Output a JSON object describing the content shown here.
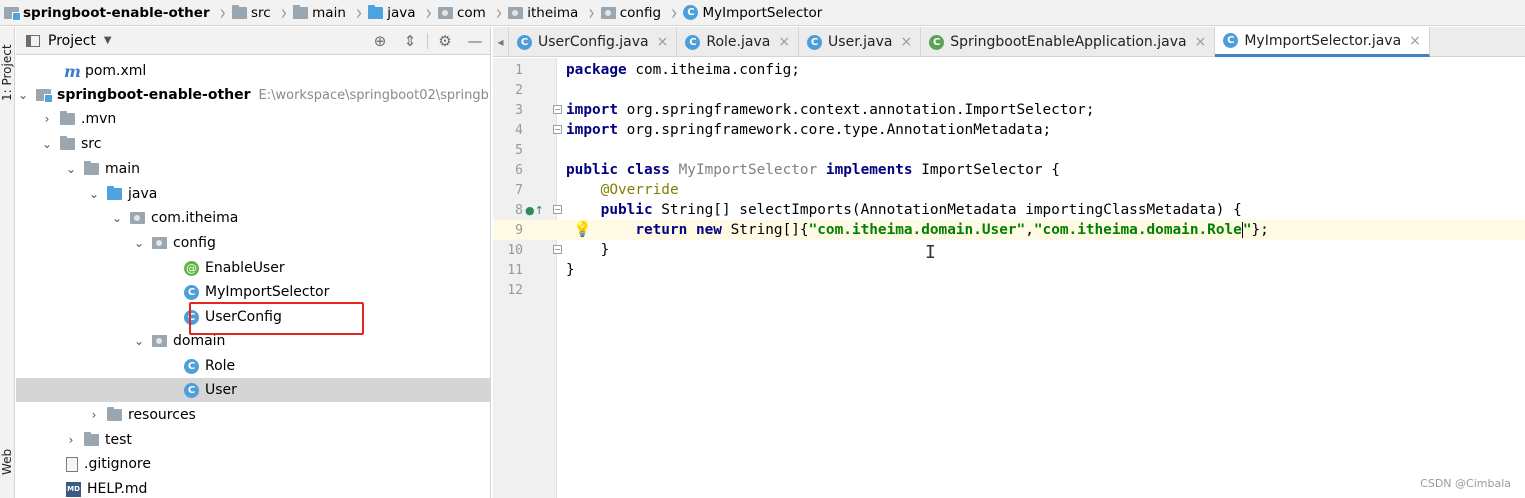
{
  "breadcrumb": [
    {
      "label": "springboot-enable-other",
      "icon": "module-icon"
    },
    {
      "label": "src",
      "icon": "folder-icon"
    },
    {
      "label": "main",
      "icon": "folder-icon"
    },
    {
      "label": "java",
      "icon": "source-folder-icon"
    },
    {
      "label": "com",
      "icon": "package-icon"
    },
    {
      "label": "itheima",
      "icon": "package-icon"
    },
    {
      "label": "config",
      "icon": "package-icon"
    },
    {
      "label": "MyImportSelector",
      "icon": "class-icon"
    }
  ],
  "left_stripe": {
    "project_label": "1: Project",
    "web_label": "Web"
  },
  "project_panel": {
    "title": "Project",
    "tree": [
      {
        "label": "pom.xml",
        "icon": "maven-icon",
        "arrow": ""
      },
      {
        "label": "springboot-enable-other",
        "path": "E:\\workspace\\springboot02\\springb",
        "icon": "module-icon",
        "arrow": "v"
      },
      {
        "label": ".mvn",
        "icon": "folder-icon",
        "arrow": ">"
      },
      {
        "label": "src",
        "icon": "folder-icon",
        "arrow": "v"
      },
      {
        "label": "main",
        "icon": "folder-icon",
        "arrow": "v"
      },
      {
        "label": "java",
        "icon": "source-folder-icon",
        "arrow": "v"
      },
      {
        "label": "com.itheima",
        "icon": "package-icon",
        "arrow": "v"
      },
      {
        "label": "config",
        "icon": "package-icon",
        "arrow": "v"
      },
      {
        "label": "EnableUser",
        "icon": "annotation-icon",
        "arrow": ""
      },
      {
        "label": "MyImportSelector",
        "icon": "class-icon",
        "arrow": ""
      },
      {
        "label": "UserConfig",
        "icon": "class-icon",
        "arrow": ""
      },
      {
        "label": "domain",
        "icon": "package-icon",
        "arrow": "v"
      },
      {
        "label": "Role",
        "icon": "class-icon",
        "arrow": ""
      },
      {
        "label": "User",
        "icon": "class-icon",
        "arrow": ""
      },
      {
        "label": "resources",
        "icon": "resources-folder-icon",
        "arrow": ">"
      },
      {
        "label": "test",
        "icon": "folder-icon",
        "arrow": ">"
      },
      {
        "label": ".gitignore",
        "icon": "file-icon",
        "arrow": ""
      },
      {
        "label": "HELP.md",
        "icon": "markdown-icon",
        "arrow": ""
      }
    ]
  },
  "tabs": [
    {
      "label": "UserConfig.java",
      "icon": "class-icon",
      "active": false
    },
    {
      "label": "Role.java",
      "icon": "class-icon",
      "active": false
    },
    {
      "label": "User.java",
      "icon": "class-icon",
      "active": false
    },
    {
      "label": "SpringbootEnableApplication.java",
      "icon": "spring-boot-class-icon",
      "active": false
    },
    {
      "label": "MyImportSelector.java",
      "icon": "class-icon",
      "active": true
    }
  ],
  "editor": {
    "line_numbers": [
      "1",
      "2",
      "3",
      "4",
      "5",
      "6",
      "7",
      "8",
      "9",
      "10",
      "11",
      "12"
    ],
    "lines": {
      "l1_kw": "package",
      "l1_rest": " com.itheima.config;",
      "l3_kw": "import",
      "l3_rest": " org.springframework.context.annotation.ImportSelector;",
      "l4_kw": "import",
      "l4_rest": " org.springframework.core.type.AnnotationMetadata;",
      "l6_kw1": "public class",
      "l6_cls": " MyImportSelector",
      "l6_kw2": " implements",
      "l6_rest": " ImportSelector {",
      "l7_ann": "@Override",
      "l8_kw": "public",
      "l8_rest": " String[] selectImports(AnnotationMetadata importingClassMetadata) {",
      "l9_kw": "return new",
      "l9_mid": " String[]{",
      "l9_str1": "\"com.itheima.domain.User\"",
      "l9_comma": ",",
      "l9_str2a": "\"com.itheima.domain.Role",
      "l9_str2b": "\"",
      "l9_end": "};",
      "l10": "}",
      "l11": "}"
    }
  },
  "watermark": "CSDN @Cimbala"
}
